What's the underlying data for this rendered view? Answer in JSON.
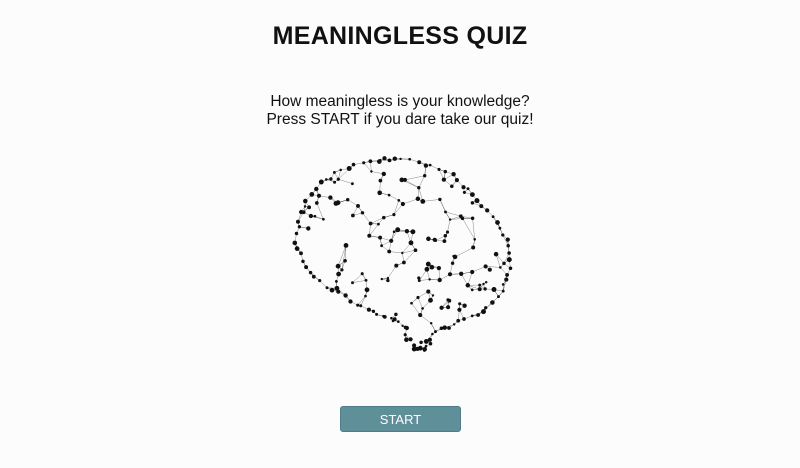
{
  "header": {
    "title": "MEANINGLESS QUIZ"
  },
  "intro": {
    "line1": "How meaningless is your knowledge?",
    "line2": "Press START if you dare take our quiz!"
  },
  "illustration": {
    "icon": "brain-network-icon",
    "color": "#111111"
  },
  "actions": {
    "start_label": "START",
    "accent": "#5f8f99"
  }
}
